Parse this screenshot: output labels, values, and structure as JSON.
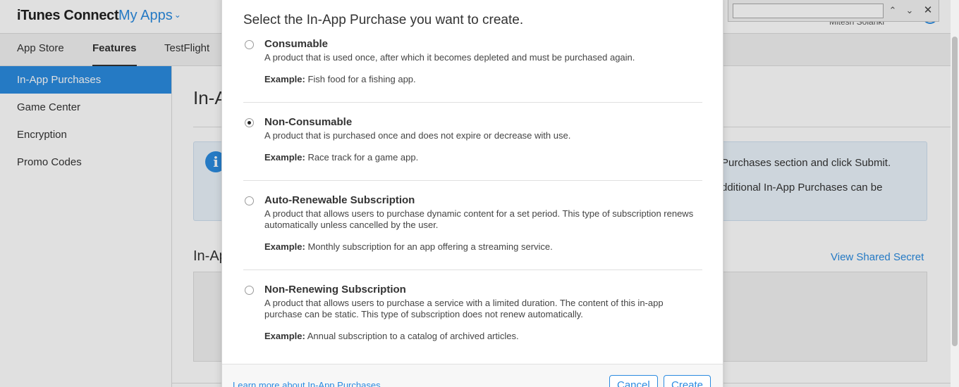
{
  "header": {
    "brand": "iTunes Connect",
    "my_apps": "My Apps",
    "user_name": "Mitesh Solanki"
  },
  "tabs": [
    {
      "label": "App Store"
    },
    {
      "label": "Features"
    },
    {
      "label": "TestFlight"
    }
  ],
  "sidebar": {
    "items": [
      {
        "label": "In-App Purchases"
      },
      {
        "label": "Game Center"
      },
      {
        "label": "Encryption"
      },
      {
        "label": "Promo Codes"
      }
    ]
  },
  "main": {
    "title": "In-App Purchases",
    "info_line1": "Purchases section and click Submit.",
    "info_line2": "dditional In-App Purchases can be",
    "section_title": "In-App Purchases",
    "shared_secret_link": "View Shared Secret"
  },
  "find_bar": {
    "value": ""
  },
  "modal": {
    "heading": "Select the In-App Purchase you want to create.",
    "example_label": "Example:",
    "options": [
      {
        "title": "Consumable",
        "description": "A product that is used once, after which it becomes depleted and must be purchased again.",
        "example": "Fish food for a fishing app.",
        "selected": false
      },
      {
        "title": "Non-Consumable",
        "description": "A product that is purchased once and does not expire or decrease with use.",
        "example": "Race track for a game app.",
        "selected": true
      },
      {
        "title": "Auto-Renewable Subscription",
        "description": "A product that allows users to purchase dynamic content for a set period. This type of subscription renews automatically unless cancelled by the user.",
        "example": "Monthly subscription for an app offering a streaming service.",
        "selected": false
      },
      {
        "title": "Non-Renewing Subscription",
        "description": "A product that allows users to purchase a service with a limited duration. The content of this in-app purchase can be static. This type of subscription does not renew automatically.",
        "example": "Annual subscription to a catalog of archived articles.",
        "selected": false
      }
    ],
    "footer": {
      "learn_more": "Learn more about In-App Purchases",
      "cancel": "Cancel",
      "create": "Create"
    }
  },
  "colors": {
    "accent": "#2b8be0",
    "overlay": "rgba(0,0,0,0.12)"
  }
}
